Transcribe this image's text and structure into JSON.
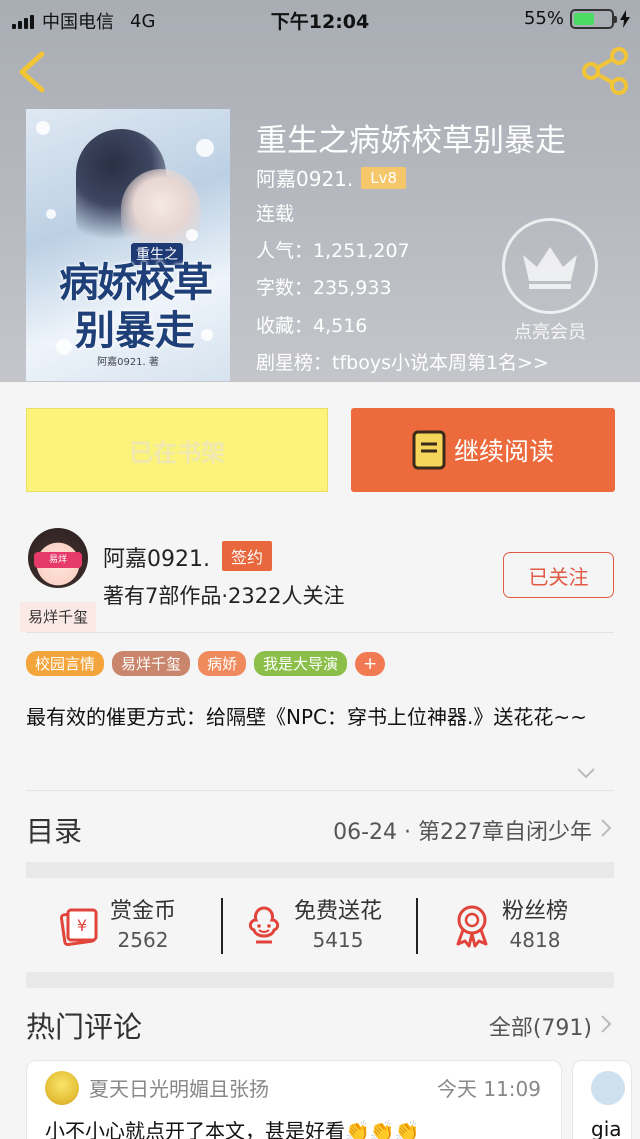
{
  "status_bar": {
    "carrier": "中国电信",
    "network": "4G",
    "time": "下午12:04",
    "battery": "55%",
    "battery_level": 0.55
  },
  "book": {
    "title": "重生之病娇校草别暴走",
    "author": "阿嘉0921.",
    "level": "Lv8",
    "status": "连载",
    "popularity": "人气：1,251,207",
    "word_count": "字数：235,933",
    "favorites": "收藏：4,516",
    "ranking": "剧星榜：tfboys小说本周第1名>>",
    "cover": {
      "badge": "重生之",
      "line1": "病娇校草",
      "line2": "别暴走",
      "author_mark": "阿嘉0921. 著"
    }
  },
  "vip": {
    "label": "点亮会员"
  },
  "actions": {
    "shelf_label": "已在书架",
    "read_label": "继续阅读"
  },
  "author_card": {
    "name": "阿嘉0921.",
    "sign_badge": "签约",
    "works": "著有7部作品·2322人关注",
    "avatar_caption": "易烊千玺",
    "avatar_mask_text": "易烊",
    "follow_label": "已关注"
  },
  "tags": [
    {
      "label": "校园言情",
      "color": "#f3a53b"
    },
    {
      "label": "易烊千玺",
      "color": "#c9866d"
    },
    {
      "label": "病娇",
      "color": "#ef8a5c"
    },
    {
      "label": "我是大导演",
      "color": "#8bbf4a"
    }
  ],
  "tag_more": "+",
  "description": "最有效的催更方式：给隔壁《NPC：穿书上位神器.》送花花~~",
  "toc": {
    "label": "目录",
    "latest": "06-24 · 第227章自闭少年"
  },
  "rewards": [
    {
      "label": "赏金币",
      "value": "2562"
    },
    {
      "label": "免费送花",
      "value": "5415"
    },
    {
      "label": "粉丝榜",
      "value": "4818"
    }
  ],
  "comments_section": {
    "label": "热门评论",
    "all_label": "全部(791)"
  },
  "comments": [
    {
      "user": "夏天日光明媚且张扬",
      "time": "今天 11:09",
      "text": "小不小心就点开了本文，甚是好看👏👏👏"
    },
    {
      "text": "gia"
    }
  ],
  "colors": {
    "accent": "#ec6a3b",
    "shelf": "#fbf37a",
    "follow": "#e15a44",
    "gold": "#f5c66a"
  }
}
